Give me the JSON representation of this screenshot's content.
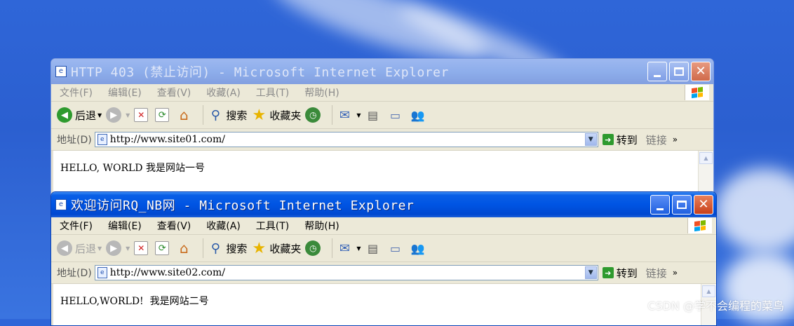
{
  "windows": [
    {
      "title": "HTTP 403 (禁止访问) - Microsoft Internet Explorer",
      "active": false,
      "menu": [
        "文件(F)",
        "编辑(E)",
        "查看(V)",
        "收藏(A)",
        "工具(T)",
        "帮助(H)"
      ],
      "toolbar": {
        "back": "后退",
        "search": "搜索",
        "favorites": "收藏夹"
      },
      "address": {
        "label": "地址(D)",
        "url": "http://www.site01.com/",
        "go": "转到",
        "links": "链接"
      },
      "content": "HELLO, WORLD 我是网站一号"
    },
    {
      "title": "欢迎访问RQ_NB网 - Microsoft Internet Explorer",
      "active": true,
      "menu": [
        "文件(F)",
        "编辑(E)",
        "查看(V)",
        "收藏(A)",
        "工具(T)",
        "帮助(H)"
      ],
      "toolbar": {
        "back": "后退",
        "search": "搜索",
        "favorites": "收藏夹"
      },
      "address": {
        "label": "地址(D)",
        "url": "http://www.site02.com/",
        "go": "转到",
        "links": "链接"
      },
      "content": "HELLO,WORLD!  我是网站二号"
    }
  ],
  "watermark": "CSDN @学不会编程的菜鸟"
}
